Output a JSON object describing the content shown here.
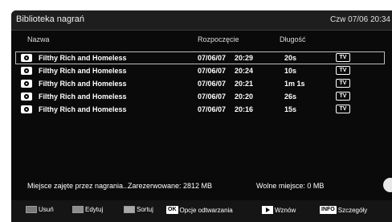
{
  "window": {
    "title": "Biblioteka nagrań",
    "clock": "Czw 07/06 20:34"
  },
  "columns": {
    "name": "Nazwa",
    "start": "Rozpoczęcie",
    "duration": "Długość"
  },
  "recordings": [
    {
      "icon": "record-icon",
      "name": "Filthy Rich and Homeless",
      "date": "07/06/07",
      "time": "20:29",
      "duration": "20s",
      "badge": "TV",
      "selected": true
    },
    {
      "icon": "record-icon",
      "name": "Filthy Rich and Homeless",
      "date": "07/06/07",
      "time": "20:24",
      "duration": "10s",
      "badge": "TV",
      "selected": false
    },
    {
      "icon": "record-icon",
      "name": "Filthy Rich and Homeless",
      "date": "07/06/07",
      "time": "20:21",
      "duration": "1m 1s",
      "badge": "TV",
      "selected": false
    },
    {
      "icon": "record-icon",
      "name": "Filthy Rich and Homeless",
      "date": "07/06/07",
      "time": "20:20",
      "duration": "26s",
      "badge": "TV",
      "selected": false
    },
    {
      "icon": "record-icon",
      "name": "Filthy Rich and Homeless",
      "date": "07/06/07",
      "time": "20:16",
      "duration": "15s",
      "badge": "TV",
      "selected": false
    }
  ],
  "status": {
    "used": "Miejsce zajęte przez nagrania...",
    "reserved": "Zarezerwowane: 2812 MB",
    "free": "Wolne miejsce: 0 MB"
  },
  "footer": {
    "red_label": "Usuń",
    "red_color": "#7a7a7a",
    "green_label": "Edytuj",
    "green_color": "#8c8c8c",
    "yellow_label": "Sortuj",
    "yellow_color": "#a8a8a8",
    "ok_badge": "OK",
    "ok_label": "Opcje odtwarzania",
    "play_label": "Wznów",
    "play_icon": "play-icon",
    "info_badge": "INFO",
    "info_label": "Szczegóły"
  }
}
